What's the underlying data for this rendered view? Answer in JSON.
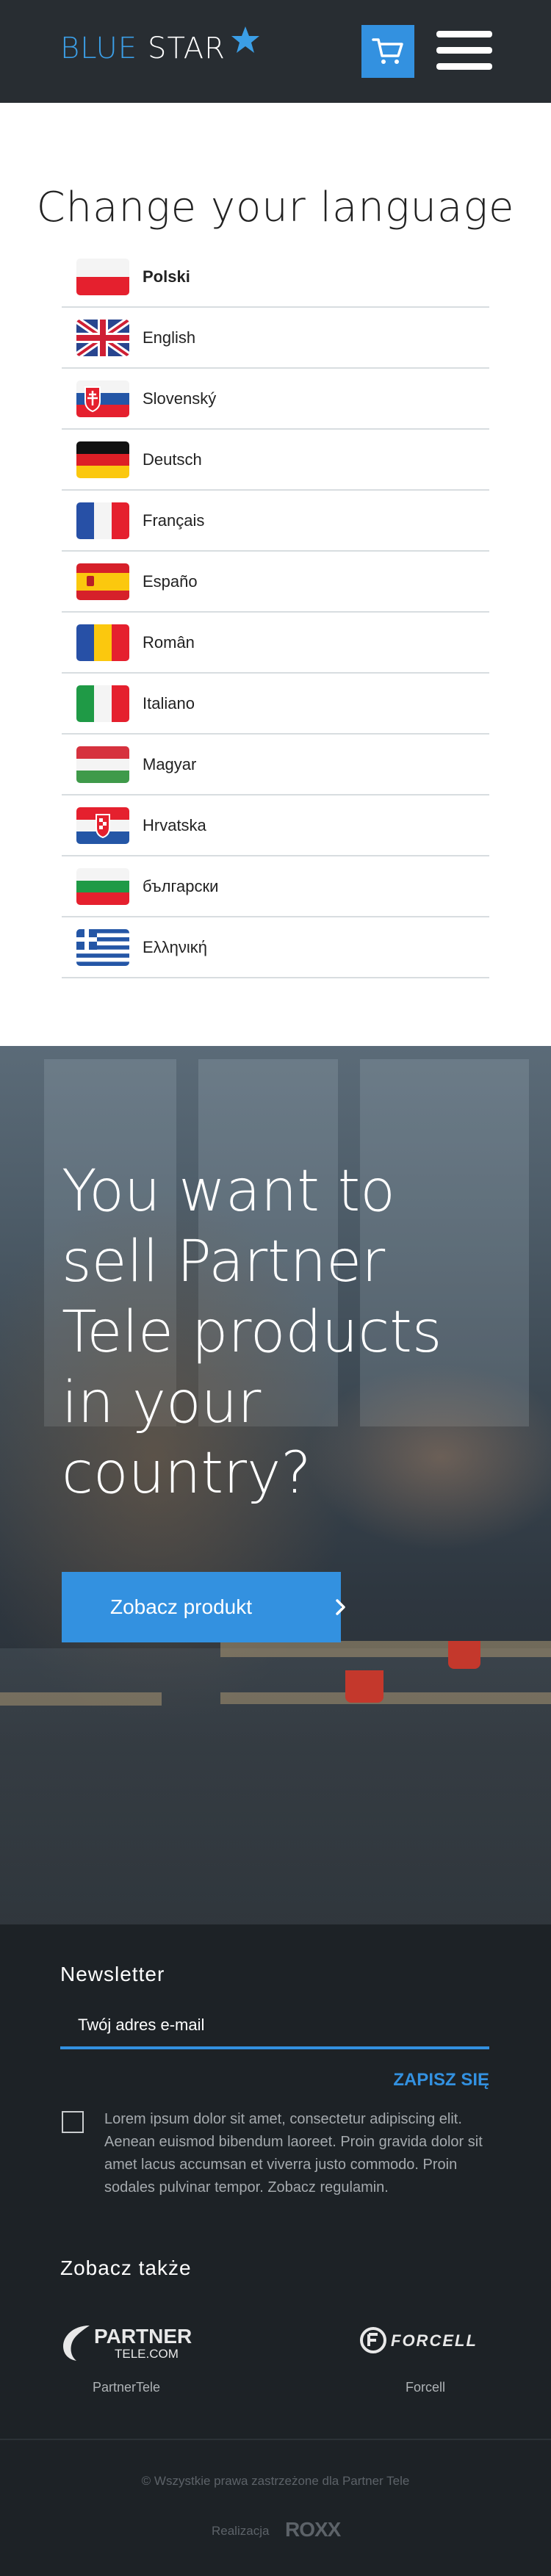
{
  "header": {
    "logo": {
      "word1": "BLUE",
      "word2": "STAR"
    },
    "colors": {
      "brand_blue": "#3391e0",
      "header_bg": "#282d32"
    },
    "icons": {
      "cart": "shopping-cart-icon",
      "menu": "hamburger-menu-icon",
      "logo_star": "star-icon"
    }
  },
  "languages": {
    "title": "Change your language",
    "items": [
      {
        "label": "Polski",
        "flag": "pl",
        "active": true
      },
      {
        "label": "English",
        "flag": "gb",
        "active": false
      },
      {
        "label": "Slovenský",
        "flag": "sk",
        "active": false
      },
      {
        "label": "Deutsch",
        "flag": "de",
        "active": false
      },
      {
        "label": "Français",
        "flag": "fr",
        "active": false
      },
      {
        "label": "Españo",
        "flag": "es",
        "active": false
      },
      {
        "label": "Român",
        "flag": "ro",
        "active": false
      },
      {
        "label": "Italiano",
        "flag": "it",
        "active": false
      },
      {
        "label": "Magyar",
        "flag": "hu",
        "active": false
      },
      {
        "label": "Hrvatska",
        "flag": "hr",
        "active": false
      },
      {
        "label": "български",
        "flag": "bg",
        "active": false
      },
      {
        "label": "Ελληνική",
        "flag": "gr",
        "active": false
      }
    ]
  },
  "hero": {
    "title_lines": [
      "You want to",
      "sell Partner",
      "Tele products",
      "in your",
      "country?"
    ],
    "button_label": "Zobacz produkt"
  },
  "newsletter": {
    "title": "Newsletter",
    "email_placeholder": "Twój adres e-mail",
    "subscribe_label": "ZAPISZ SIĘ",
    "consent_text": "Lorem ipsum dolor sit amet, consectetur adipiscing elit. Aenean euismod bibendum laoreet. Proin gravida dolor sit amet lacus accumsan et viverra justo commodo. Proin sodales pulvinar tempor. Zobacz regulamin.",
    "consent_checked": false
  },
  "see_also": {
    "title": "Zobacz także",
    "partners": [
      {
        "label": "PartnerTele",
        "logo_line1": "PARTNER",
        "logo_line2": "TELE.COM"
      },
      {
        "label": "Forcell",
        "logo_text": "FORCELL"
      }
    ]
  },
  "footer": {
    "copyright": "© Wszystkie prawa zastrzeżone dla Partner Tele",
    "made_by_label": "Realizacja",
    "made_by_brand": "ROXX"
  }
}
